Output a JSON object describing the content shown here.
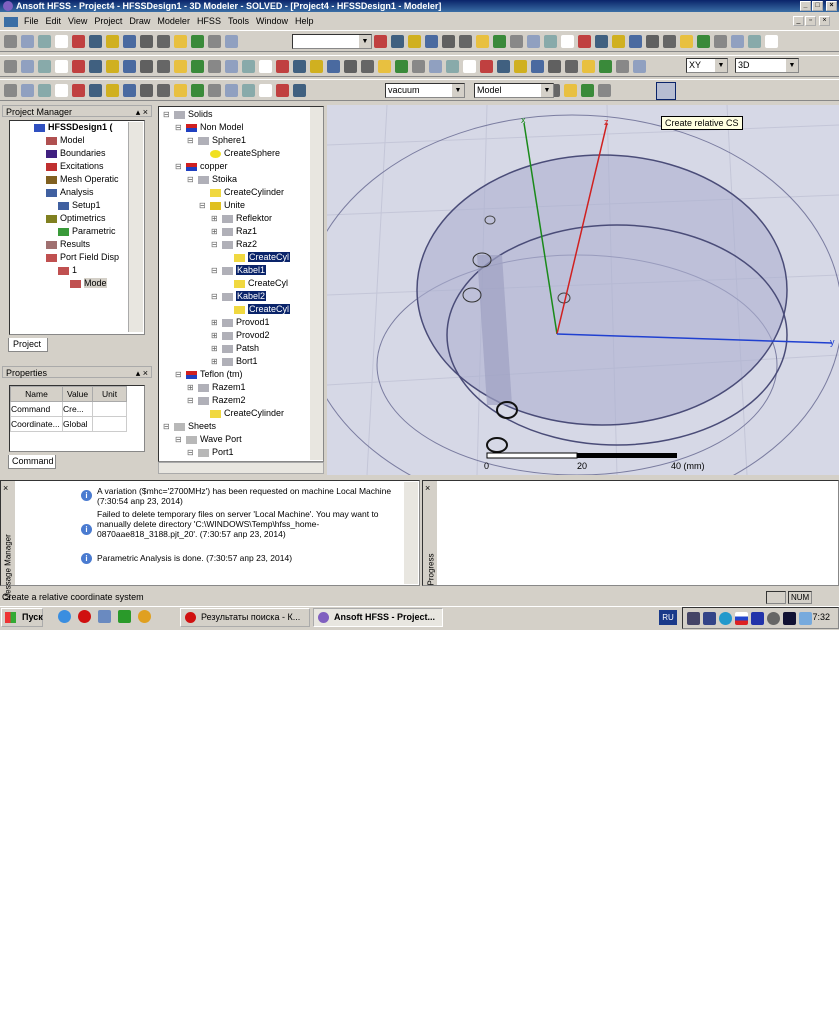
{
  "window": {
    "title": "Ansoft HFSS - Project4 - HFSSDesign1 - 3D Modeler - SOLVED - [Project4 - HFSSDesign1 - Modeler]"
  },
  "menu": [
    "File",
    "Edit",
    "View",
    "Project",
    "Draw",
    "Modeler",
    "HFSS",
    "Tools",
    "Window",
    "Help"
  ],
  "toolbar": {
    "material": "vacuum",
    "model": "Model",
    "plane": "XY",
    "view": "3D",
    "tooltip": "Create relative CS"
  },
  "project_manager": {
    "title": "Project Manager",
    "tab": "Project",
    "items": [
      {
        "label": "HFSSDesign1 (",
        "level": 0
      },
      {
        "label": "Model",
        "level": 1
      },
      {
        "label": "Boundaries",
        "level": 1
      },
      {
        "label": "Excitations",
        "level": 1
      },
      {
        "label": "Mesh Operatic",
        "level": 1
      },
      {
        "label": "Analysis",
        "level": 1
      },
      {
        "label": "Setup1",
        "level": 2
      },
      {
        "label": "Optimetrics",
        "level": 1
      },
      {
        "label": "Parametric",
        "level": 2
      },
      {
        "label": "Results",
        "level": 1
      },
      {
        "label": "Port Field Disp",
        "level": 1
      },
      {
        "label": "1",
        "level": 2
      },
      {
        "label": "Mode",
        "level": 3
      }
    ]
  },
  "properties": {
    "title": "Properties",
    "tab": "Command",
    "headers": [
      "Name",
      "Value",
      "Unit"
    ],
    "rows": [
      [
        "Command",
        "Cre...",
        ""
      ],
      [
        "Coordinate...",
        "Global",
        ""
      ]
    ]
  },
  "model_tree": [
    {
      "label": "Solids",
      "level": 0,
      "icon": "solid"
    },
    {
      "label": "Non Model",
      "level": 1,
      "icon": "material"
    },
    {
      "label": "Sphere1",
      "level": 2,
      "icon": "solid"
    },
    {
      "label": "CreateSphere",
      "level": 3,
      "icon": "sphere"
    },
    {
      "label": "copper",
      "level": 1,
      "icon": "material"
    },
    {
      "label": "Stoika",
      "level": 2,
      "icon": "solid"
    },
    {
      "label": "CreateCylinder",
      "level": 3,
      "icon": "cyl"
    },
    {
      "label": "Unite",
      "level": 3,
      "icon": "unite"
    },
    {
      "label": "Reflektor",
      "level": 4,
      "icon": "solid"
    },
    {
      "label": "Raz1",
      "level": 4,
      "icon": "solid"
    },
    {
      "label": "Raz2",
      "level": 4,
      "icon": "solid"
    },
    {
      "label": "CreateCyl",
      "level": 5,
      "icon": "cyl",
      "hl": true
    },
    {
      "label": "Kabel1",
      "level": 4,
      "icon": "solid",
      "hl": true
    },
    {
      "label": "CreateCyl",
      "level": 5,
      "icon": "cyl"
    },
    {
      "label": "Kabel2",
      "level": 4,
      "icon": "solid",
      "hl": true
    },
    {
      "label": "CreateCyl",
      "level": 5,
      "icon": "cyl",
      "hl": true
    },
    {
      "label": "Provod1",
      "level": 4,
      "icon": "solid"
    },
    {
      "label": "Provod2",
      "level": 4,
      "icon": "solid"
    },
    {
      "label": "Patsh",
      "level": 4,
      "icon": "solid"
    },
    {
      "label": "Bort1",
      "level": 4,
      "icon": "solid"
    },
    {
      "label": "Teflon (tm)",
      "level": 1,
      "icon": "material"
    },
    {
      "label": "Razem1",
      "level": 2,
      "icon": "solid"
    },
    {
      "label": "Razem2",
      "level": 2,
      "icon": "solid"
    },
    {
      "label": "CreateCylinder",
      "level": 3,
      "icon": "cyl"
    },
    {
      "label": "Sheets",
      "level": 0,
      "icon": "sheet"
    },
    {
      "label": "Wave Port",
      "level": 1,
      "icon": "sheet"
    },
    {
      "label": "Port1",
      "level": 2,
      "icon": "sheet"
    }
  ],
  "viewport": {
    "axes": [
      "x",
      "y",
      "z"
    ],
    "scale": [
      "0",
      "20",
      "40 (mm)"
    ]
  },
  "messages": {
    "side_label": "Message Manager",
    "items": [
      "A variation ($mhc='2700MHz') has been requested on machine Local Machine (7:30:54  апр 23, 2014)",
      "Failed to delete temporary files on server 'Local Machine'. You may want to manually delete directory 'C:\\WINDOWS\\Temp\\hfss_home-0870aae818_3188.pjt_20'. (7:30:57  апр 23, 2014)",
      "Parametric Analysis is done. (7:30:57  апр 23, 2014)"
    ]
  },
  "progress": {
    "side_label": "Progress"
  },
  "status": {
    "text": "Create a relative coordinate system",
    "num": "NUM"
  },
  "taskbar": {
    "start": "Пуск",
    "tasks": [
      "Результаты поиска - К...",
      "Ansoft HFSS - Project..."
    ],
    "lang": "RU",
    "clock": "7:32"
  }
}
